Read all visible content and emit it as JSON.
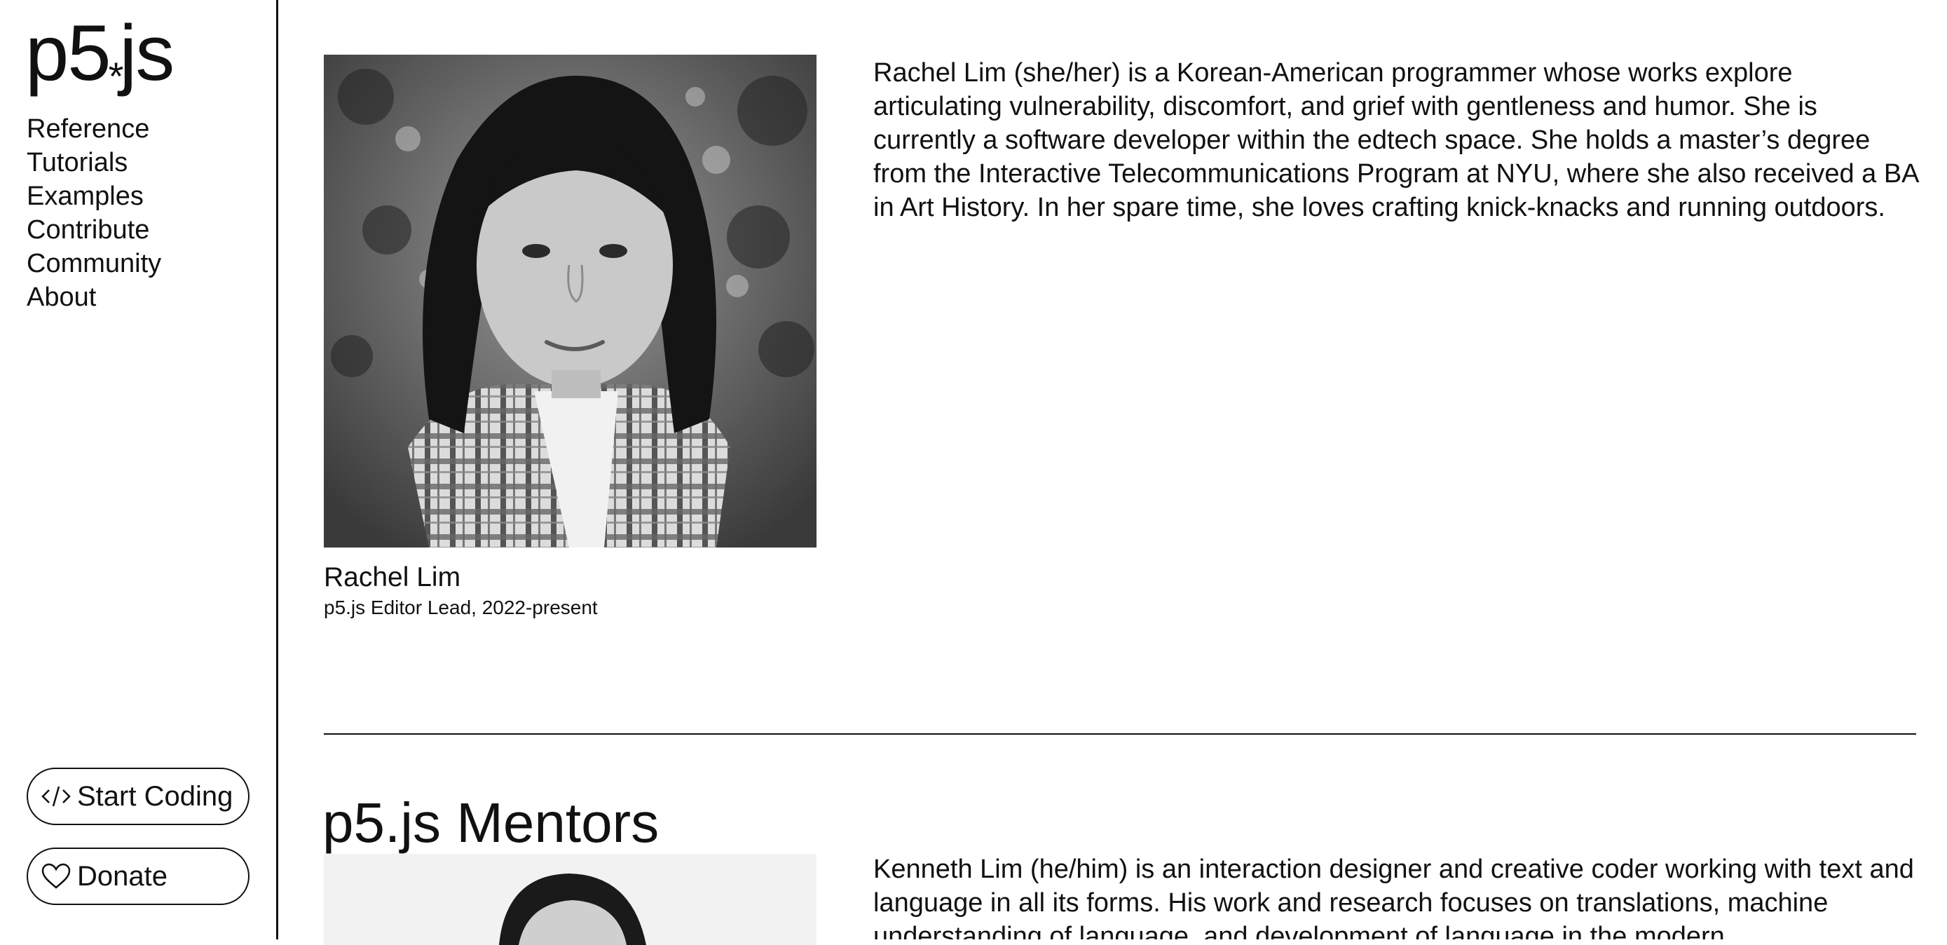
{
  "sidebar": {
    "logo": {
      "left": "p5",
      "star": "*",
      "right": "js"
    },
    "nav": [
      "Reference",
      "Tutorials",
      "Examples",
      "Contribute",
      "Community",
      "About"
    ],
    "start_coding_label": "Start Coding",
    "donate_label": "Donate"
  },
  "people": [
    {
      "name": "Rachel Lim",
      "role": "p5.js Editor Lead, 2022-present",
      "bio": "Rachel Lim (she/her) is a Korean-American programmer whose works explore articulating vulnerability, discomfort, and grief with gentleness and humor. She is currently a software developer within the edtech space. She holds a master’s degree from the Interactive Telecommunications Program at NYU, where she also received a BA in Art History. In her spare time, she loves crafting knick-knacks and running outdoors."
    },
    {
      "bio": "Kenneth Lim (he/him) is an interaction designer and creative coder working with text and language in all its forms. His work and research focuses on translations, machine understanding of language, and development of language in the modern"
    }
  ],
  "sections": {
    "mentors_heading": "p5.js Mentors"
  },
  "icons": {
    "code": "code-icon",
    "heart": "heart-icon"
  }
}
